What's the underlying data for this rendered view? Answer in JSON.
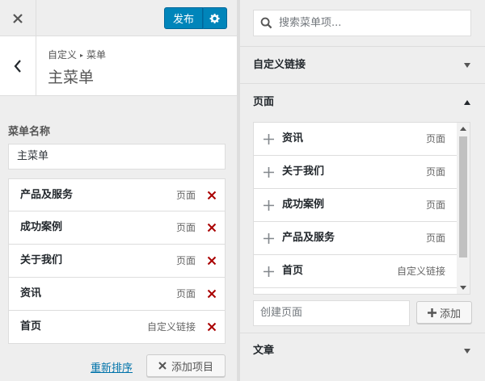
{
  "topbar": {
    "close_icon": "close-icon",
    "publish_label": "发布",
    "settings_icon": "gear-icon"
  },
  "header": {
    "breadcrumb_parent": "自定义",
    "breadcrumb_current": "菜单",
    "title": "主菜单"
  },
  "menu_name": {
    "label": "菜单名称",
    "value": "主菜单"
  },
  "menu_items": [
    {
      "title": "产品及服务",
      "type": "页面"
    },
    {
      "title": "成功案例",
      "type": "页面"
    },
    {
      "title": "关于我们",
      "type": "页面"
    },
    {
      "title": "资讯",
      "type": "页面"
    },
    {
      "title": "首页",
      "type": "自定义链接"
    }
  ],
  "footer": {
    "reorder_label": "重新排序",
    "add_items_label": "添加项目"
  },
  "search": {
    "placeholder": "搜索菜单项..."
  },
  "sections": {
    "custom_links": "自定义链接",
    "pages": "页面",
    "posts": "文章"
  },
  "available_pages": [
    {
      "title": "资讯",
      "type": "页面"
    },
    {
      "title": "关于我们",
      "type": "页面"
    },
    {
      "title": "成功案例",
      "type": "页面"
    },
    {
      "title": "产品及服务",
      "type": "页面"
    },
    {
      "title": "首页",
      "type": "自定义链接"
    }
  ],
  "new_page": {
    "placeholder": "创建页面",
    "add_label": "添加"
  },
  "colors": {
    "accent": "#0085ba",
    "delete": "#a00",
    "link": "#0073aa"
  }
}
